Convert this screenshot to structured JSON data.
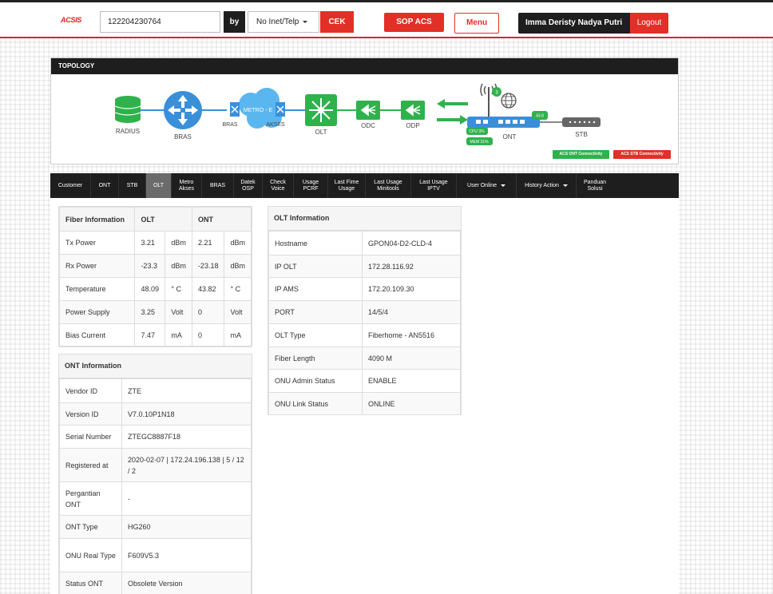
{
  "header": {
    "logo": "ACSIS",
    "search_value": "122204230764",
    "by_label": "by",
    "search_type": "No Inet/Telp",
    "cek_label": "CEK",
    "sop_label": "SOP ACS",
    "menu_label": "Menu",
    "user_name": "Imma Deristy Nadya Putri",
    "logout_label": "Logout"
  },
  "topology": {
    "title": "TOPOLOGY",
    "nodes": {
      "radius": "RADIUS",
      "bras": "BRAS",
      "metro_bras": "BRAS",
      "metro": "METRO - E",
      "akses": "AKSES",
      "olt": "OLT",
      "odc": "ODC",
      "odp": "ODP",
      "ont": "ONT",
      "stb": "STB"
    },
    "wifi_count": "3",
    "signal": "43.8",
    "cpu": "CPU 3%",
    "mem": "MEM 31%",
    "acs_ont": "ACS ONT Connectivity",
    "acs_stb": "ACS STB Connectivity",
    "colors": {
      "green": "#2fb24c",
      "blue": "#3a8fd9",
      "red": "#e23028"
    }
  },
  "nav": {
    "items": [
      {
        "label": "Customer"
      },
      {
        "label": "ONT"
      },
      {
        "label": "STB"
      },
      {
        "label": "OLT"
      },
      {
        "label": "Metro Akses"
      },
      {
        "label": "BRAS"
      },
      {
        "label": "Datek OSP"
      },
      {
        "label": "Check Voice"
      },
      {
        "label": "Usage PCRF"
      },
      {
        "label": "Last Fime Usage"
      },
      {
        "label": "Last Usage Minitools"
      },
      {
        "label": "Last Usage IPTV"
      },
      {
        "label": "User Online"
      },
      {
        "label": "History Action"
      },
      {
        "label": "Panduan Solusi"
      }
    ]
  },
  "fiber": {
    "headers": [
      "Fiber Information",
      "OLT",
      "ONT"
    ],
    "rows": [
      {
        "label": "Tx Power",
        "olt": "3.21",
        "olt_unit": "dBm",
        "ont": "2.21",
        "ont_unit": "dBm"
      },
      {
        "label": "Rx Power",
        "olt": "-23.3",
        "olt_unit": "dBm",
        "ont": "-23.18",
        "ont_unit": "dBm"
      },
      {
        "label": "Temperature",
        "olt": "48.09",
        "olt_unit": "° C",
        "ont": "43.82",
        "ont_unit": "° C"
      },
      {
        "label": "Power Supply",
        "olt": "3.25",
        "olt_unit": "Volt",
        "ont": "0",
        "ont_unit": "Volt"
      },
      {
        "label": "Bias Current",
        "olt": "7.47",
        "olt_unit": "mA",
        "ont": "0",
        "ont_unit": "mA"
      }
    ]
  },
  "ont_info": {
    "title": "ONT Information",
    "rows": [
      {
        "label": "Vendor ID",
        "value": "ZTE"
      },
      {
        "label": "Version ID",
        "value": "V7.0.10P1N18"
      },
      {
        "label": "Serial Number",
        "value": "ZTEGC8887F18"
      },
      {
        "label": "Registered at",
        "value": "2020-02-07 | 172.24.196.138 | 5 / 12 / 2"
      },
      {
        "label": "Pergantian ONT",
        "value": "-"
      },
      {
        "label": "ONT Type",
        "value": "HG260"
      },
      {
        "label": "ONU Real Type",
        "value": "F609V5.3"
      },
      {
        "label": "Status ONT",
        "value": "Obsolete Version"
      }
    ]
  },
  "olt_info": {
    "title": "OLT Information",
    "rows": [
      {
        "label": "Hostname",
        "value": "GPON04-D2-CLD-4"
      },
      {
        "label": "IP OLT",
        "value": "172.28.116.92"
      },
      {
        "label": "IP AMS",
        "value": "172.20.109.30"
      },
      {
        "label": "PORT",
        "value": "14/5/4"
      },
      {
        "label": "OLT Type",
        "value": "Fiberhome - AN5516"
      },
      {
        "label": "Fiber Length",
        "value": "4090 M"
      },
      {
        "label": "ONU Admin Status",
        "value": "ENABLE"
      },
      {
        "label": "ONU Link Status",
        "value": "ONLINE"
      }
    ]
  }
}
